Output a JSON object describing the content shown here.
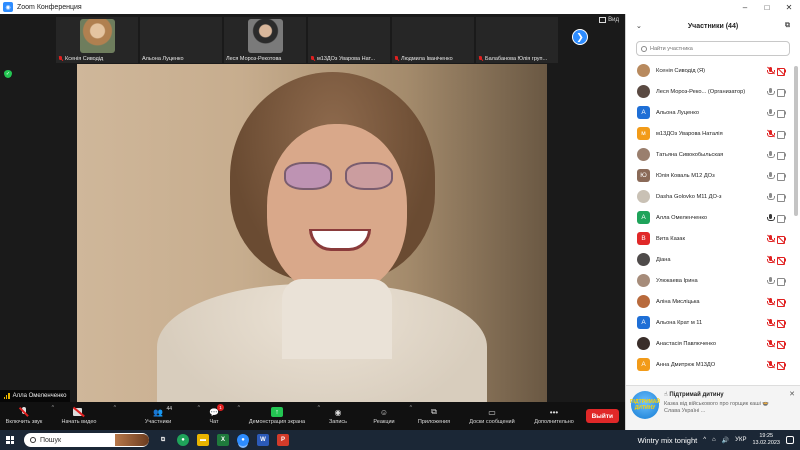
{
  "window": {
    "title": "Zoom Конференция",
    "app_icon": "zoom-logo"
  },
  "meeting": {
    "view_label": "Вид",
    "thumbnails": [
      {
        "name": "Ксенія Сиводід",
        "muted": true,
        "photo": "thumb-1"
      },
      {
        "name": "Альона Луценко",
        "muted": false,
        "photo": ""
      },
      {
        "name": "Леся Мороз-Рекотова",
        "muted": false,
        "photo": "thumb-2"
      },
      {
        "name": "м13ДОз Уварова Нат...",
        "muted": true,
        "photo": ""
      },
      {
        "name": "Людмила Іваніченко",
        "muted": true,
        "photo": ""
      },
      {
        "name": "Балабанова Юлія груп...",
        "muted": true,
        "photo": ""
      }
    ],
    "active_speaker": "Алла Омеленченко"
  },
  "toolbar": {
    "mute": "Включить звук",
    "video": "Начать видео",
    "participants": "Участники",
    "participants_count": "44",
    "chat": "Чат",
    "chat_badge": "1",
    "share": "Демонстрация экрана",
    "record": "Запись",
    "reactions": "Реакции",
    "apps": "Приложения",
    "whiteboard": "Доски сообщений",
    "more": "Дополнительно",
    "leave": "Выйти"
  },
  "panel": {
    "title": "Участники (44)",
    "search_placeholder": "Найти участника",
    "participants": [
      {
        "name": "Ксенія Сиводід (Я)",
        "avatar": "photo",
        "letter": "",
        "color": "#b88a5e",
        "mic": "off",
        "cam": "off"
      },
      {
        "name": "Леся Мороз-Реко... (Организатор)",
        "avatar": "photo",
        "letter": "",
        "color": "#5a4a42",
        "mic": "on",
        "cam": "on"
      },
      {
        "name": "Альона Луценко",
        "avatar": "letter",
        "letter": "А",
        "color": "#1f6fd6",
        "mic": "on",
        "cam": "on"
      },
      {
        "name": "м13ДОз Уварова Наталія",
        "avatar": "letter",
        "letter": "м",
        "color": "#f29b19",
        "mic": "off",
        "cam": "on"
      },
      {
        "name": "Татьяна Сивокобыльская",
        "avatar": "photo",
        "letter": "",
        "color": "#9a7f6e",
        "mic": "on",
        "cam": "on"
      },
      {
        "name": "Юлія Коваль М12 ДОз",
        "avatar": "letter",
        "letter": "Ю",
        "color": "#8a6a58",
        "mic": "on",
        "cam": "on"
      },
      {
        "name": "Dasha Golovko M11 ДО-з",
        "avatar": "photo",
        "letter": "",
        "color": "#c9c1b5",
        "mic": "on",
        "cam": "on"
      },
      {
        "name": "Алла Омеленченко",
        "avatar": "letter",
        "letter": "А",
        "color": "#1fa35a",
        "mic": "speaking",
        "cam": "on"
      },
      {
        "name": "Вита Казак",
        "avatar": "letter",
        "letter": "В",
        "color": "#e02828",
        "mic": "off",
        "cam": "off"
      },
      {
        "name": "Діана",
        "avatar": "photo",
        "letter": "",
        "color": "#4f4b4a",
        "mic": "off",
        "cam": "off"
      },
      {
        "name": "Улюкаева Ірина",
        "avatar": "photo",
        "letter": "",
        "color": "#a68c7a",
        "mic": "on",
        "cam": "on"
      },
      {
        "name": "Аліна Мисліцька",
        "avatar": "photo",
        "letter": "",
        "color": "#b86a3c",
        "mic": "off",
        "cam": "off"
      },
      {
        "name": "Альона Крат м 11",
        "avatar": "letter",
        "letter": "А",
        "color": "#1f6fd6",
        "mic": "off",
        "cam": "off"
      },
      {
        "name": "Анастасія Павлюченко",
        "avatar": "photo",
        "letter": "",
        "color": "#3a2e2a",
        "mic": "off",
        "cam": "off"
      },
      {
        "name": "Анна Дмитрюк М13ДО",
        "avatar": "letter",
        "letter": "А",
        "color": "#f29b19",
        "mic": "off",
        "cam": "off"
      }
    ],
    "notification": {
      "title": "☝ Підтримай дитину",
      "text": "Казка від військового про горщик каші 🍲 Слава Україні ...",
      "logo_text": "ПІДТРИМАЙ ДИТИНУ"
    }
  },
  "taskbar": {
    "search": "Пошук",
    "weather": "Wintry mix tonight",
    "lang": "УКР",
    "time": "19:25",
    "date": "13.02.2023"
  },
  "colors": {
    "accent": "#2d8cff",
    "mute_red": "#e02020",
    "share_green": "#23c552",
    "leave_red": "#e02828"
  }
}
